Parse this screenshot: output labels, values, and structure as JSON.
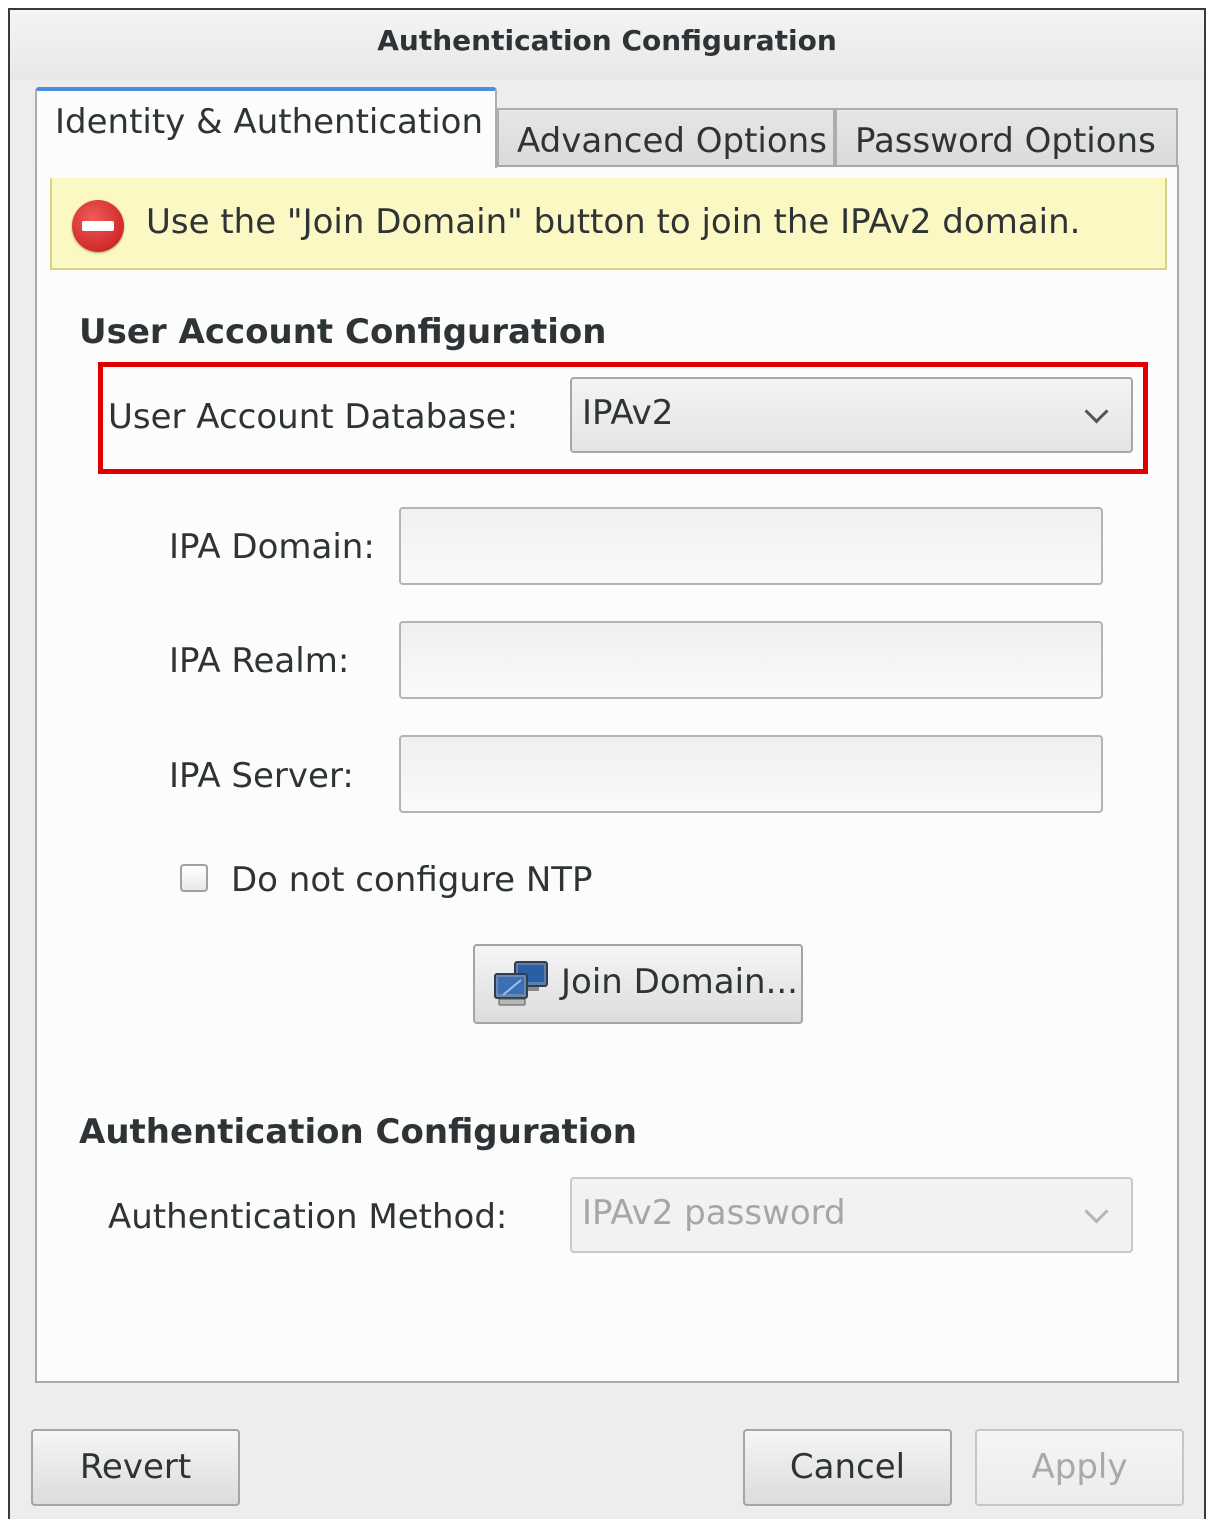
{
  "window": {
    "title": "Authentication Configuration"
  },
  "tabs": [
    {
      "label": "Identity & Authentication",
      "active": true
    },
    {
      "label": "Advanced Options",
      "active": false
    },
    {
      "label": "Password Options",
      "active": false
    }
  ],
  "infobar": {
    "icon": "stop-icon",
    "message": "Use the \"Join Domain\" button to join the IPAv2 domain."
  },
  "user_account": {
    "section_title": "User Account Configuration",
    "database_label": "User Account Database:",
    "database_value": "IPAv2",
    "ipa_domain_label": "IPA Domain:",
    "ipa_domain_value": "",
    "ipa_realm_label": "IPA Realm:",
    "ipa_realm_value": "",
    "ipa_server_label": "IPA Server:",
    "ipa_server_value": "",
    "ntp_checkbox_label": "Do not configure NTP",
    "ntp_checked": false,
    "join_button_label": "Join Domain...",
    "join_button_icon": "network-computers-icon"
  },
  "authentication": {
    "section_title": "Authentication Configuration",
    "method_label": "Authentication Method:",
    "method_value": "IPAv2 password"
  },
  "buttons": {
    "revert": "Revert",
    "cancel": "Cancel",
    "apply": "Apply"
  },
  "colors": {
    "highlight_border": "#e00000",
    "active_tab_accent": "#4a90d9",
    "infobar_background": "#fbf8c3",
    "stop_icon": "#d81f1f"
  }
}
